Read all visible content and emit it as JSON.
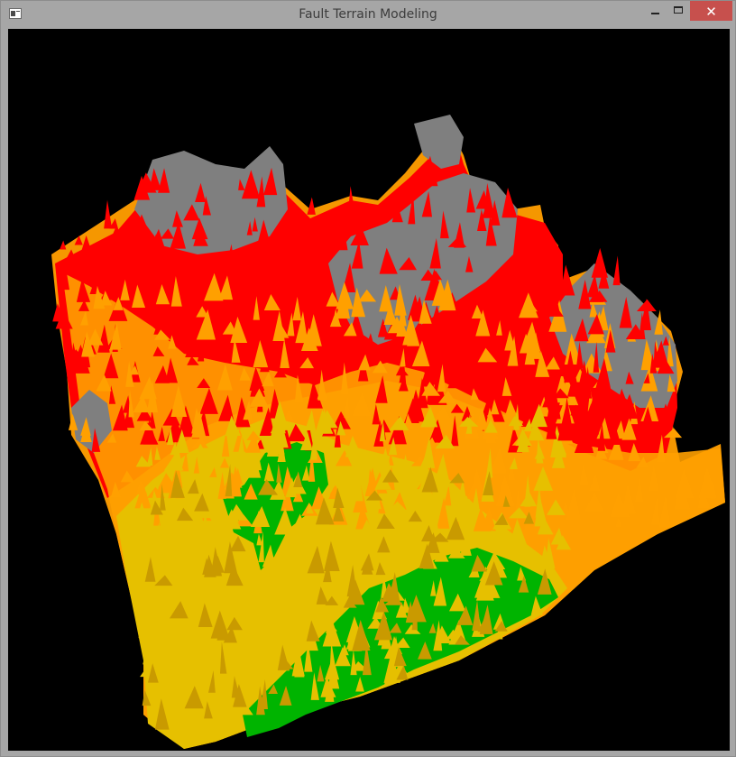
{
  "window": {
    "title": "Fault Terrain Modeling",
    "controls": {
      "minimize": "minimize-icon",
      "maximize": "maximize-icon",
      "close": "close-icon",
      "close_glyph": "✕"
    }
  },
  "colors": {
    "titlebar": "#a6a6a6",
    "close_button": "#c7504d",
    "background": "#000000",
    "terrain_levels": [
      "#00b400",
      "#e6c800",
      "#ffa000",
      "#ff0000",
      "#7f7f7f"
    ]
  }
}
